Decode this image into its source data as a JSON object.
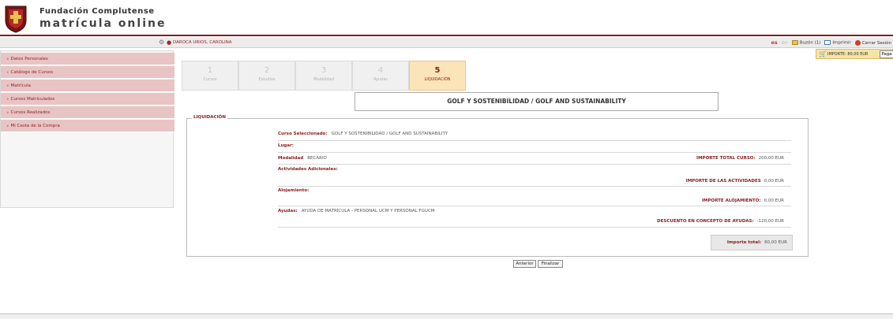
{
  "header": {
    "org_name": "Fundación Complutense",
    "app_name": "matrícula  online"
  },
  "userbar": {
    "username": "DAROCA URIOS, CAROLINA",
    "lang_es": "es",
    "lang_en": "en",
    "mailbox": "Buzón (1)",
    "print": "Imprimir",
    "logout": "Cerrar Sesión"
  },
  "cart": {
    "amount": "IMPORTE: 80,00 EUR",
    "pay_label": "Paga"
  },
  "sidebar": {
    "items": [
      {
        "label": "Datos Personales"
      },
      {
        "label": "Catálogo de Cursos"
      },
      {
        "label": "Matrícula"
      },
      {
        "label": "Cursos Matriculados"
      },
      {
        "label": "Cursos Realizados"
      },
      {
        "label": "Mi Cesta de la Compra"
      }
    ]
  },
  "steps": [
    {
      "num": "1",
      "label": "Cursos"
    },
    {
      "num": "2",
      "label": "Estudios"
    },
    {
      "num": "3",
      "label": "Modalidad"
    },
    {
      "num": "4",
      "label": "Ayudas"
    },
    {
      "num": "5",
      "label": "LIQUIDACIÓN"
    }
  ],
  "course_title": "GOLF Y SOSTENIBILIDAD / GOLF AND SUSTAINABILITY",
  "liquidacion": {
    "legend": "LIQUIDACIÓN",
    "curso_label": "Curso Seleccionado:",
    "curso_value": "GOLF Y SOSTENIBILIDAD / GOLF AND SUSTAINABILITY",
    "lugar_label": "Lugar:",
    "modalidad_label": "Modalidad",
    "modalidad_value": "BECARIO",
    "importe_curso_label": "IMPORTE TOTAL CURSO:",
    "importe_curso_value": "200,00 EUR",
    "actividades_label": "Actividades Adicionales:",
    "importe_actividades_label": "IMPORTE DE LAS ACTIVIDADES",
    "importe_actividades_value": "0,00 EUR",
    "alojamiento_label": "Alojamiento:",
    "importe_alojamiento_label": "IMPORTE ALOJAMIENTO:",
    "importe_alojamiento_value": "0,00 EUR",
    "ayudas_label": "Ayudas:",
    "ayudas_value": "AYUDA DE MATRÍCULA - PERSONAL UCM Y PERSONAL FGUCM",
    "descuento_label": "DESCUENTO EN CONCEPTO DE AYUDAS:",
    "descuento_value": "-120,00 EUR",
    "total_label": "Importe total:",
    "total_value": "80,00 EUR"
  },
  "buttons": {
    "previous": "Anterior",
    "finish": "Finalizar"
  },
  "colors": {
    "brand": "#8b1a1a",
    "menu_bg": "#e8c4c4",
    "active_step": "#fbe4b8",
    "cart_bg": "#f6e3a6"
  }
}
